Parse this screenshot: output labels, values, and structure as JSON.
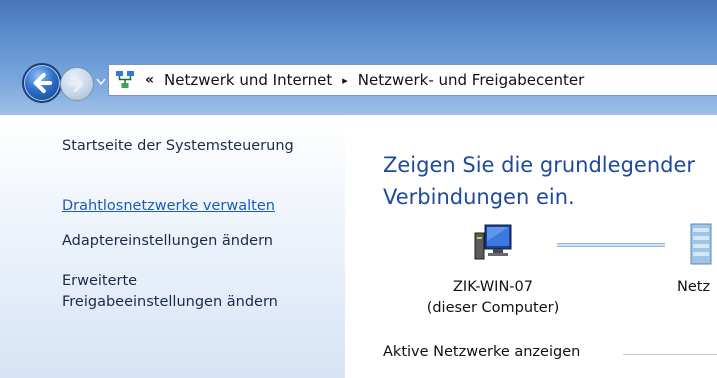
{
  "breadcrumb": {
    "overflow": "«",
    "segments": [
      "Netzwerk und Internet",
      "Netzwerk- und Freigabecenter"
    ],
    "separator": "▸"
  },
  "sidebar": {
    "home": "Startseite der Systemsteuerung",
    "items": [
      "Drahtlosnetzwerke verwalten",
      "Adaptereinstellungen ändern",
      "Erweiterte",
      "Freigabeeinstellungen ändern"
    ]
  },
  "main": {
    "heading_line1": "Zeigen Sie die grundlegender",
    "heading_line2": "Verbindungen ein.",
    "computer_name": "ZIK-WIN-07",
    "computer_sub": "(dieser Computer)",
    "network_label": "Netz",
    "active_networks": "Aktive Netzwerke anzeigen"
  },
  "icons": {
    "back": "back-arrow-icon",
    "forward": "forward-arrow-icon",
    "network_center": "network-center-icon",
    "computer": "computer-icon",
    "network": "network-icon"
  },
  "colors": {
    "link": "#1a5bb8",
    "heading": "#1e4a9a"
  }
}
